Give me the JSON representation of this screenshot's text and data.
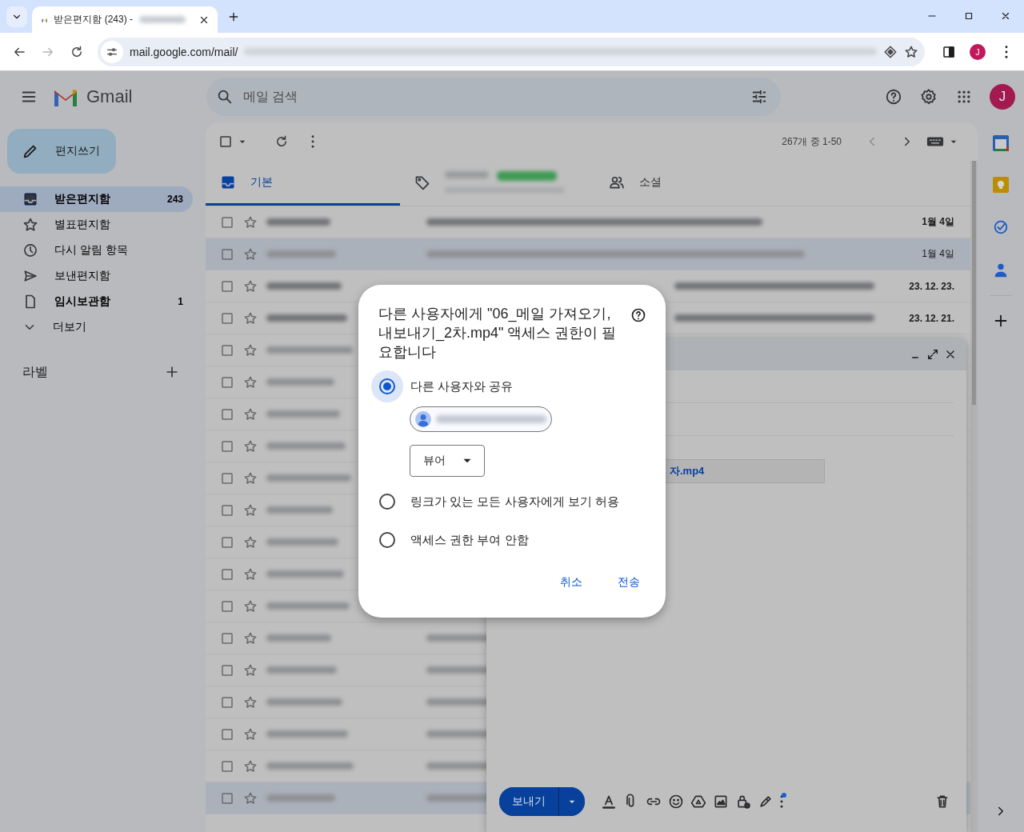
{
  "browser": {
    "tab": {
      "title": "받은편지함 (243) -",
      "selected": true
    },
    "address": "mail.google.com/mail/",
    "forward_disabled": true,
    "profile_initial": "J"
  },
  "gmail": {
    "app_name": "Gmail",
    "search_placeholder": "메일 검색",
    "avatar_initial": "J",
    "compose_label": "편지쓰기",
    "nav": [
      {
        "kind": "inbox",
        "label": "받은편지함",
        "count": "243",
        "selected": true,
        "unread": true
      },
      {
        "kind": "star",
        "label": "별표편지함",
        "selected": false,
        "unread": false
      },
      {
        "kind": "snooze",
        "label": "다시 알림 항목",
        "selected": false,
        "unread": false
      },
      {
        "kind": "sent",
        "label": "보낸편지함",
        "selected": false,
        "unread": false
      },
      {
        "kind": "draft",
        "label": "임시보관함",
        "count": "1",
        "selected": false,
        "unread": true
      },
      {
        "kind": "more",
        "label": "더보기",
        "selected": false,
        "unread": false
      }
    ],
    "labels_heading": "라벨",
    "pager": {
      "range": "267개 중 1-50",
      "previous_disabled": true
    },
    "tabs": [
      {
        "kind": "primary",
        "label": "기본",
        "selected": true
      },
      {
        "kind": "promotions",
        "selected": false
      },
      {
        "kind": "social",
        "label": "소셜",
        "selected": false
      }
    ],
    "rows": [
      {
        "unread": true,
        "highlighted": false,
        "date": "1월 4일"
      },
      {
        "unread": false,
        "highlighted": true,
        "date": "1월 4일"
      },
      {
        "unread": true,
        "highlighted": false,
        "date": "23. 12. 23."
      },
      {
        "unread": true,
        "highlighted": false,
        "date": "23. 12. 21."
      },
      {
        "unread": false,
        "highlighted": false
      },
      {
        "unread": false,
        "highlighted": false
      },
      {
        "unread": false,
        "highlighted": false
      },
      {
        "unread": false,
        "highlighted": false
      },
      {
        "unread": false,
        "highlighted": false
      },
      {
        "unread": false,
        "highlighted": false
      },
      {
        "unread": false,
        "highlighted": false
      },
      {
        "unread": false,
        "highlighted": false
      },
      {
        "unread": false,
        "highlighted": false
      },
      {
        "unread": false,
        "highlighted": false
      },
      {
        "unread": false,
        "highlighted": false
      },
      {
        "unread": false,
        "highlighted": false
      },
      {
        "unread": false,
        "highlighted": false
      },
      {
        "unread": false,
        "highlighted": false
      },
      {
        "unread": false,
        "highlighted": true
      }
    ]
  },
  "compose": {
    "attachment": "자.mp4",
    "send_label": "보내기"
  },
  "dialog": {
    "title": "다른 사용자에게 \"06_메일 가져오기, 내보내기_2차.mp4\" 액세스 권한이 필요합니다",
    "options": [
      {
        "label": "다른 사용자와 공유",
        "selected": true
      },
      {
        "label": "링크가 있는 모든 사용자에게 보기 허용",
        "selected": false
      },
      {
        "label": "액세스 권한 부여 안함",
        "selected": false
      }
    ],
    "role": "뷰어",
    "buttons": [
      "취소",
      "전송"
    ]
  }
}
